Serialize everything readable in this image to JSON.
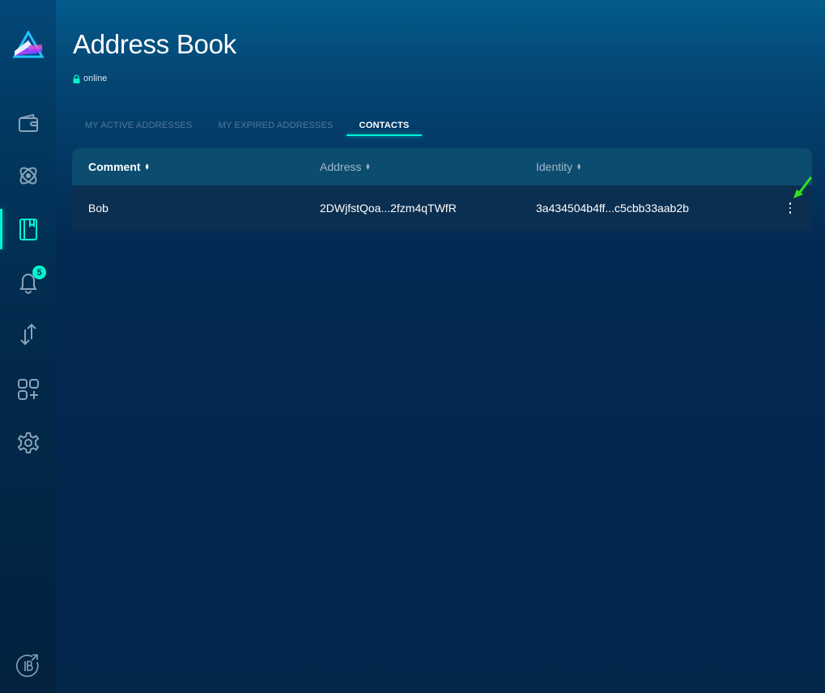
{
  "page": {
    "title": "Address Book",
    "status": "online"
  },
  "sidebar": {
    "items": [
      {
        "icon": "wallet-icon"
      },
      {
        "icon": "atom-icon"
      },
      {
        "icon": "address-book-icon",
        "active": true
      },
      {
        "icon": "bell-icon",
        "badge": "5"
      },
      {
        "icon": "transfer-icon"
      },
      {
        "icon": "apps-icon"
      },
      {
        "icon": "gear-icon"
      }
    ],
    "bottom_icon": "external-beam-icon"
  },
  "tabs": [
    {
      "label": "MY ACTIVE ADDRESSES"
    },
    {
      "label": "MY EXPIRED ADDRESSES"
    },
    {
      "label": "CONTACTS",
      "active": true
    }
  ],
  "table": {
    "headers": [
      "Comment",
      "Address",
      "Identity"
    ],
    "rows": [
      {
        "comment": "Bob",
        "address": "2DWjfstQoa...2fzm4qTWfR",
        "identity": "3a434504b4ff...c5cbb33aab2b"
      }
    ]
  },
  "colors": {
    "accent": "#00f6d2",
    "background": "#032548",
    "annotation_arrow": "#34e21f"
  }
}
